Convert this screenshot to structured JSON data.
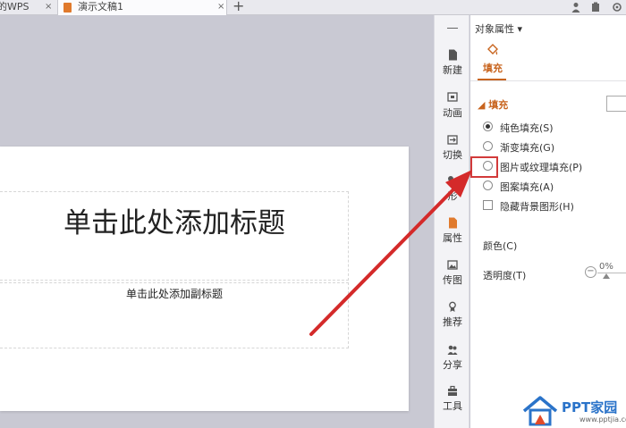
{
  "tabs": {
    "wps_label": "的WPS",
    "doc_label": "演示文稿1",
    "close_glyph": "×",
    "new_tab_glyph": "+"
  },
  "slide": {
    "title_placeholder": "单击此处添加标题",
    "subtitle_placeholder": "单击此处添加副标题"
  },
  "tool_strip": {
    "items": [
      {
        "label": "新建",
        "icon": "new-file-icon"
      },
      {
        "label": "动画",
        "icon": "animation-icon"
      },
      {
        "label": "切换",
        "icon": "transition-icon"
      },
      {
        "label": "形",
        "icon": "shape-icon"
      },
      {
        "label": "属性",
        "icon": "properties-icon"
      },
      {
        "label": "传图",
        "icon": "upload-image-icon"
      },
      {
        "label": "推荐",
        "icon": "recommend-icon"
      },
      {
        "label": "分享",
        "icon": "share-icon"
      },
      {
        "label": "工具",
        "icon": "toolbox-icon"
      }
    ]
  },
  "panel": {
    "title": "对象属性",
    "dropdown_glyph": "▾",
    "fill_tab_label": "填充",
    "section_title": "◢ 填充",
    "fill_options": [
      {
        "label": "纯色填充(S)",
        "selected": true
      },
      {
        "label": "渐变填充(G)",
        "selected": false
      },
      {
        "label": "图片或纹理填充(P)",
        "selected": false
      },
      {
        "label": "图案填充(A)",
        "selected": false
      }
    ],
    "hide_bg_label": "隐藏背景图形(H)",
    "color_label": "颜色(C)",
    "transparency_label": "透明度(T)",
    "transparency_value": "0%",
    "minus_glyph": "−"
  },
  "watermark": {
    "text": "PPT家园",
    "url": "www.pptjia.com"
  },
  "colors": {
    "accent": "#c8641e",
    "highlight": "#d23a3a",
    "watermark_blue": "#2a73c9"
  }
}
